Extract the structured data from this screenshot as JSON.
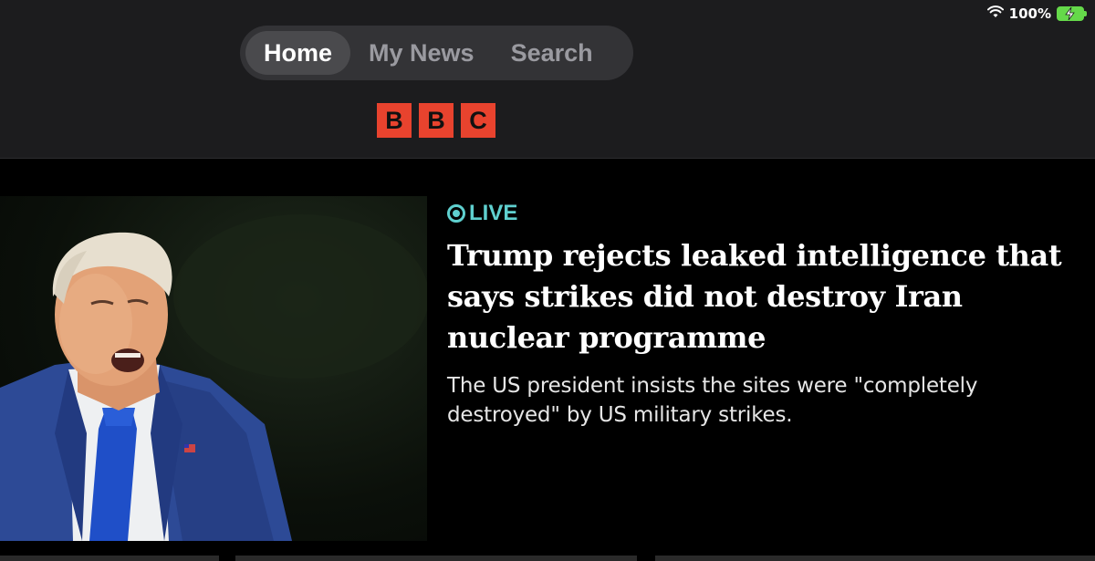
{
  "status_bar": {
    "battery": "100%"
  },
  "nav": {
    "tabs": [
      {
        "label": "Home",
        "active": true
      },
      {
        "label": "My News",
        "active": false
      },
      {
        "label": "Search",
        "active": false
      }
    ]
  },
  "logo": {
    "letters": [
      "B",
      "B",
      "C"
    ],
    "color": "#e8432e"
  },
  "article": {
    "badge": "LIVE",
    "headline": "Trump rejects leaked intelligence that says strikes did not destroy Iran nuclear programme",
    "summary": "The US president insists the sites were \"completely destroyed\" by US military strikes."
  },
  "colors": {
    "live_accent": "#5fd0cf",
    "header_bg": "#1c1c1e",
    "page_bg": "#000000"
  }
}
